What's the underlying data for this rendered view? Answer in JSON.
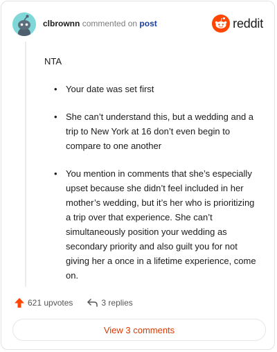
{
  "header": {
    "username": "clbrownn",
    "commented_on": "commented on",
    "post_link": "post",
    "brand": "reddit"
  },
  "comment": {
    "intro": "NTA",
    "bullets": [
      "Your date was set first",
      "She can’t understand this, but a wedding and a trip to New York at 16 don’t even begin to compare to one another",
      "You mention in comments that she’s especially upset because she didn’t feel included in her mother’s wedding, but it’s her who is prioritizing a trip over that experience. She can’t simultaneously position your wedding as secondary priority and also guilt you for not giving her a once in a lifetime experience, come on."
    ]
  },
  "actions": {
    "upvotes": "621 upvotes",
    "replies": "3 replies"
  },
  "view_comments_label": "View 3 comments",
  "colors": {
    "accent": "#d93a00",
    "upvote": "#ff4500",
    "post_link": "#1a3c9a",
    "avatar_bg": "#7fd7d8"
  }
}
